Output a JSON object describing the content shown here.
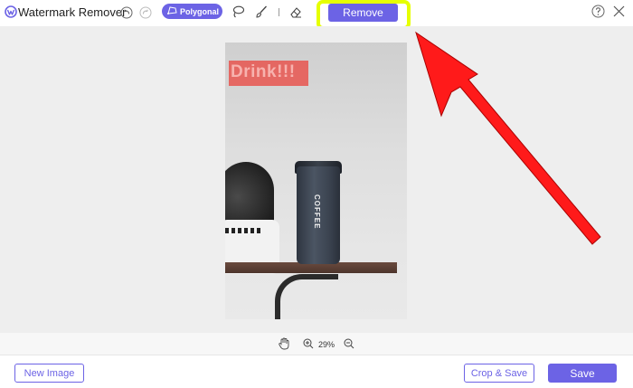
{
  "app": {
    "title": "Watermark Remover"
  },
  "toolbar": {
    "undo_icon": "undo-icon",
    "redo_icon": "redo-icon",
    "polygonal_label": "Polygonal",
    "lasso_icon": "lasso-icon",
    "brush_icon": "brush-icon",
    "eraser_icon": "eraser-icon",
    "remove_label": "Remove",
    "help_icon": "help-icon",
    "close_icon": "close-icon"
  },
  "image": {
    "watermark_text": "Drink!!!",
    "cup_text": "COFFEE"
  },
  "zoom": {
    "hand_icon": "hand-icon",
    "zoom_in_icon": "zoom-in-icon",
    "value": "29%",
    "zoom_out_icon": "zoom-out-icon"
  },
  "footer": {
    "new_image_label": "New Image",
    "crop_save_label": "Crop & Save",
    "save_label": "Save"
  },
  "colors": {
    "accent": "#6c63e5",
    "highlight": "#e6ff00",
    "annotation_arrow": "#ff1a1a",
    "watermark_box": "#e8554f"
  }
}
